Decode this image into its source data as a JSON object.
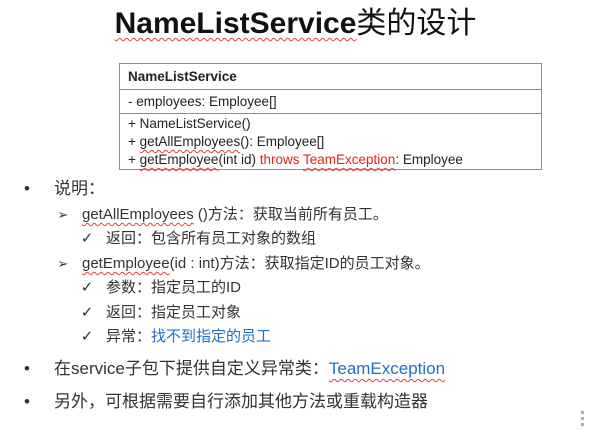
{
  "title": {
    "en": "NameListService",
    "zh": "类的设计"
  },
  "uml": {
    "class_name": "NameListService",
    "attribute": "- employees: Employee[]",
    "op1": "+ NameListService()",
    "op2_prefix": "+ ",
    "op2_name": "getAllEmployees",
    "op2_suffix": "(): Employee[]",
    "op3_prefix": "+ ",
    "op3_name": "getEmployee",
    "op3_params": "(int id) ",
    "op3_throws": "throws ",
    "op3_exception": "TeamException",
    "op3_suffix": ": Employee"
  },
  "bullets": {
    "symbol": "•",
    "arrow": "➢",
    "check": "✓",
    "explain_label": "说明：",
    "item_getall_name": "getAllEmployees",
    "item_getall_desc": " ()方法：获取当前所有员工。",
    "item_getall_return": "返回：包含所有员工对象的数组",
    "item_getemp_name": "getEmployee",
    "item_getemp_desc": "(id : int)方法：获取指定ID的员工对象。",
    "item_getemp_param": "参数：指定员工的ID",
    "item_getemp_return": "返回：指定员工对象",
    "item_getemp_exception_label": "异常：",
    "item_getemp_exception_text": "找不到指定的员工",
    "service_prefix": "在service子包下提供自定义异常类：",
    "service_exception": "TeamException",
    "extra_text": "另外，可根据需要自行添加其他方法或重载构造器"
  },
  "colors": {
    "border": "#71a74f",
    "red": "#e8211a",
    "blue": "#1f6fc5"
  }
}
